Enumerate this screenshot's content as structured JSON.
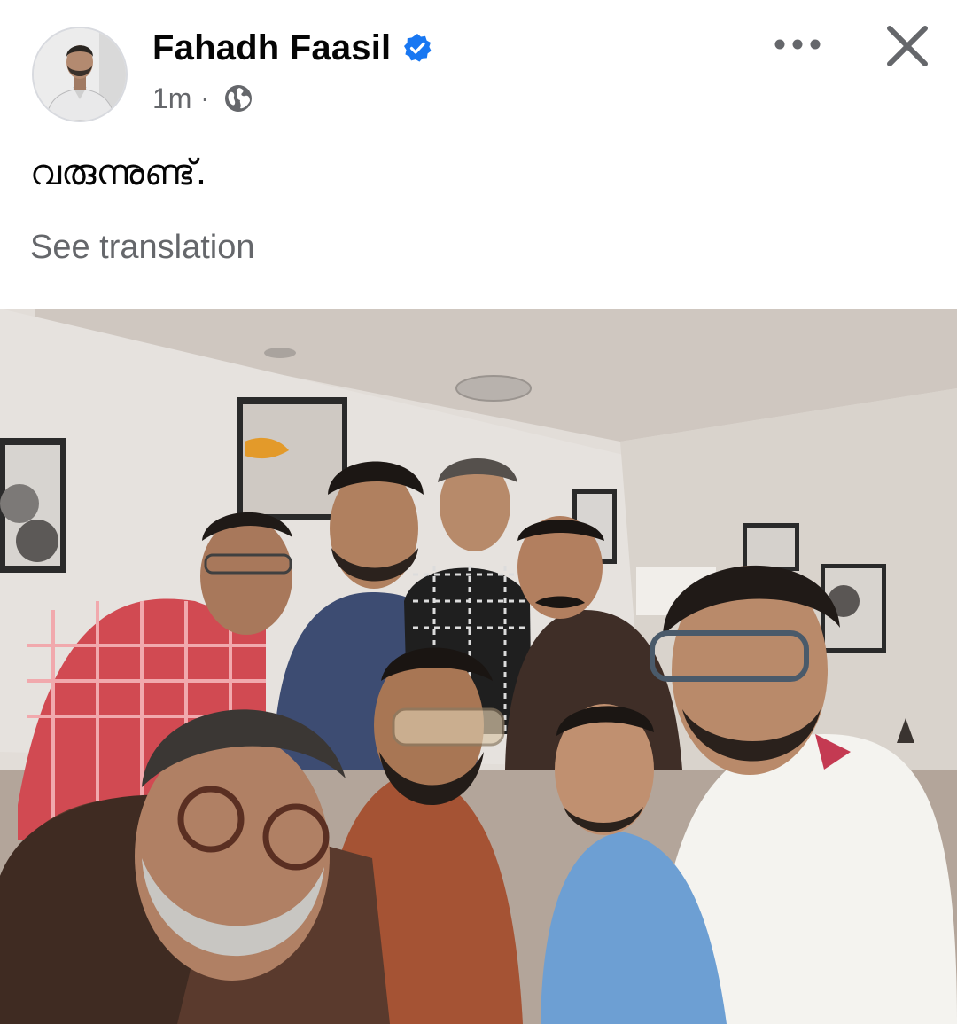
{
  "post": {
    "author": {
      "name": "Fahadh Faasil",
      "verified": true,
      "avatar_icon": "profile-photo"
    },
    "timestamp": "1m",
    "separator": "·",
    "audience_icon": "globe-icon",
    "text": "വരുന്നുണ്ട്.",
    "translation_link": "See translation",
    "photo": {
      "description_icon": "group-selfie-photo"
    }
  },
  "actions": {
    "more_icon": "more-options-icon",
    "close_icon": "close-icon"
  },
  "colors": {
    "text_primary": "#050505",
    "text_secondary": "#65676b",
    "verified_blue": "#1877f2"
  }
}
